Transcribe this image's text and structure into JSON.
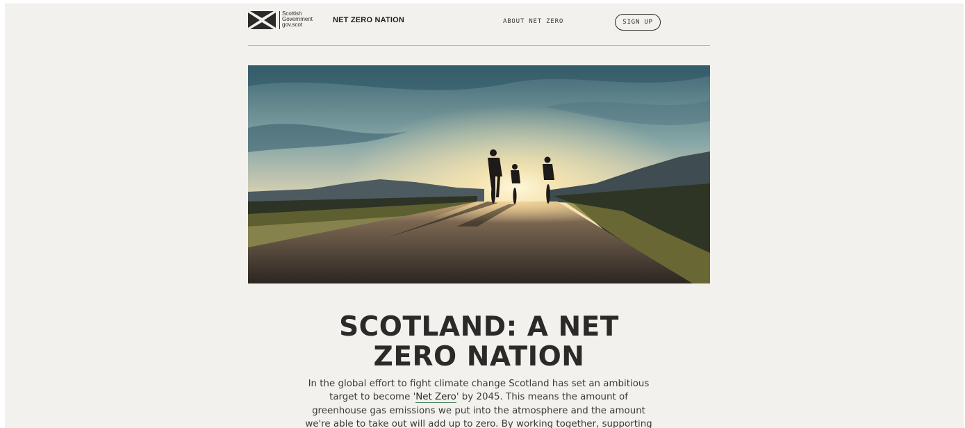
{
  "header": {
    "logo": {
      "line1": "Scottish",
      "line2": "Government",
      "line3": "gov.scot",
      "icon": "saltire-flag-icon"
    },
    "site_name": "NET ZERO NATION",
    "nav": {
      "about_label": "ABOUT NET ZERO",
      "signup_label": "SIGN UP"
    }
  },
  "hero": {
    "image_description_icon": "cyclists-sunset-road-image"
  },
  "main": {
    "headline_line1": "SCOTLAND: A NET",
    "headline_line2": "ZERO NATION",
    "intro_before_link": "In the global effort to fight climate change Scotland has set an ambitious target to become '",
    "intro_link": "Net Zero",
    "intro_after_link": "' by 2045. This means the amount of greenhouse gas emissions we put into the atmosphere and the amount we're able to take out will add up to zero. By working together, supporting each other and"
  },
  "colors": {
    "page_background": "#f3f1ed",
    "text": "#2b2a28",
    "link_underline": "#3f7f54"
  }
}
